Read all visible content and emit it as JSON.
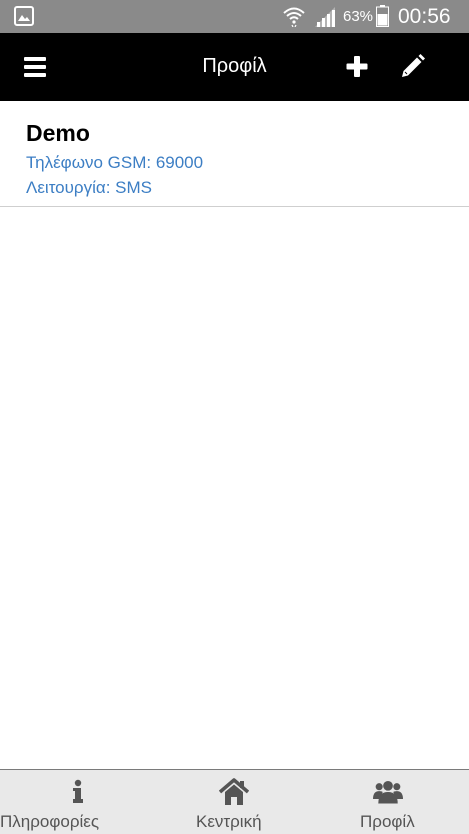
{
  "status_bar": {
    "battery_percent": "63%",
    "time": "00:56",
    "icons": [
      "gallery-icon",
      "wifi-icon",
      "signal-icon",
      "battery-icon"
    ]
  },
  "app_bar": {
    "title": "Προφίλ",
    "icons": [
      "menu-icon",
      "plus-icon",
      "pencil-icon"
    ]
  },
  "profiles": [
    {
      "name": "Demo",
      "phone": "Τηλέφωνο GSM: 69000",
      "mode": "Λειτουργία: SMS"
    }
  ],
  "bottom_nav": {
    "items": [
      {
        "label": "Πληροφορίες",
        "icon": "info-icon"
      },
      {
        "label": "Κεντρική",
        "icon": "home-icon"
      },
      {
        "label": "Προφίλ",
        "icon": "users-icon"
      }
    ]
  },
  "colors": {
    "status_bar_bg": "#8a8a8a",
    "app_bar_bg": "#000000",
    "link_blue": "#3c7ec4",
    "nav_bg": "#e9e9e9",
    "nav_text": "#555555"
  }
}
